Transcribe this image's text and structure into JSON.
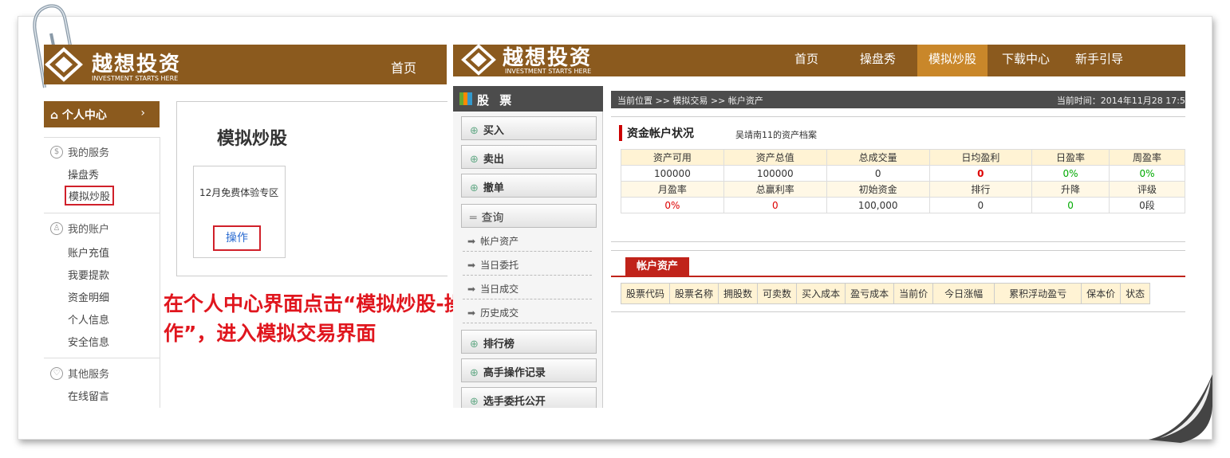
{
  "left_panel": {
    "logo_title": "越想投资",
    "logo_sub": "INVESTMENT STARTS HERE",
    "home_label": "首页",
    "personal_center": "个人中心",
    "sidebar": {
      "services_title": "我的服务",
      "services": [
        "操盘秀",
        "模拟炒股"
      ],
      "account_title": "我的账户",
      "account": [
        "账户充值",
        "我要提款",
        "资金明细",
        "个人信息",
        "安全信息"
      ],
      "other_title": "其他服务",
      "other": [
        "在线留言"
      ]
    },
    "card_heading": "模拟炒股",
    "card_label": "12月免费体验专区",
    "card_button": "操作"
  },
  "instruction": "在个人中心界面点击“模拟炒股-操作”，进入模拟交易界面",
  "right_panel": {
    "logo_title": "越想投资",
    "logo_sub": "INVESTMENT STARTS HERE",
    "nav": [
      "首页",
      "操盘秀",
      "模拟炒股",
      "下载中心",
      "新手引导"
    ],
    "nav_active": "模拟炒股",
    "stock_header": "股 票",
    "menu": [
      "买入",
      "卖出",
      "撤单"
    ],
    "query_label": "查询",
    "query_items": [
      "帐户资产",
      "当日委托",
      "当日成交",
      "历史成交"
    ],
    "menu_bottom": [
      "排行榜",
      "高手操作记录",
      "选手委托公开"
    ],
    "breadcrumb": "当前位置 >> 模拟交易 >> 帐户资产",
    "current_time": "当前时间：2014年11月28 17:5",
    "section_title": "资金帐户状况",
    "section_sub": "吴靖南11的资产档案",
    "table_row1_headers": [
      "资产可用",
      "资产总值",
      "总成交量",
      "日均盈利",
      "日盈率",
      "周盈率"
    ],
    "table_row1_values": [
      "100000",
      "100000",
      "0",
      "0",
      "0%",
      "0%"
    ],
    "table_row2_headers": [
      "月盈率",
      "总赢利率",
      "初始资金",
      "排行",
      "升降",
      "评级"
    ],
    "table_row2_values": [
      "0%",
      "0",
      "100,000",
      "0",
      "0",
      "0段"
    ],
    "account_tab": "帐户资产",
    "holdings_headers": [
      "股票代码",
      "股票名称",
      "拥股数",
      "可卖数",
      "买入成本",
      "盈亏成本",
      "当前价",
      "今日涨幅",
      "累积浮动盈亏",
      "保本价",
      "状态"
    ]
  },
  "colors": {
    "brand_brown": "#8b5a1e",
    "nav_active": "#c9872a",
    "accent_red": "#d0202a",
    "instruction_red": "#e0161e"
  }
}
